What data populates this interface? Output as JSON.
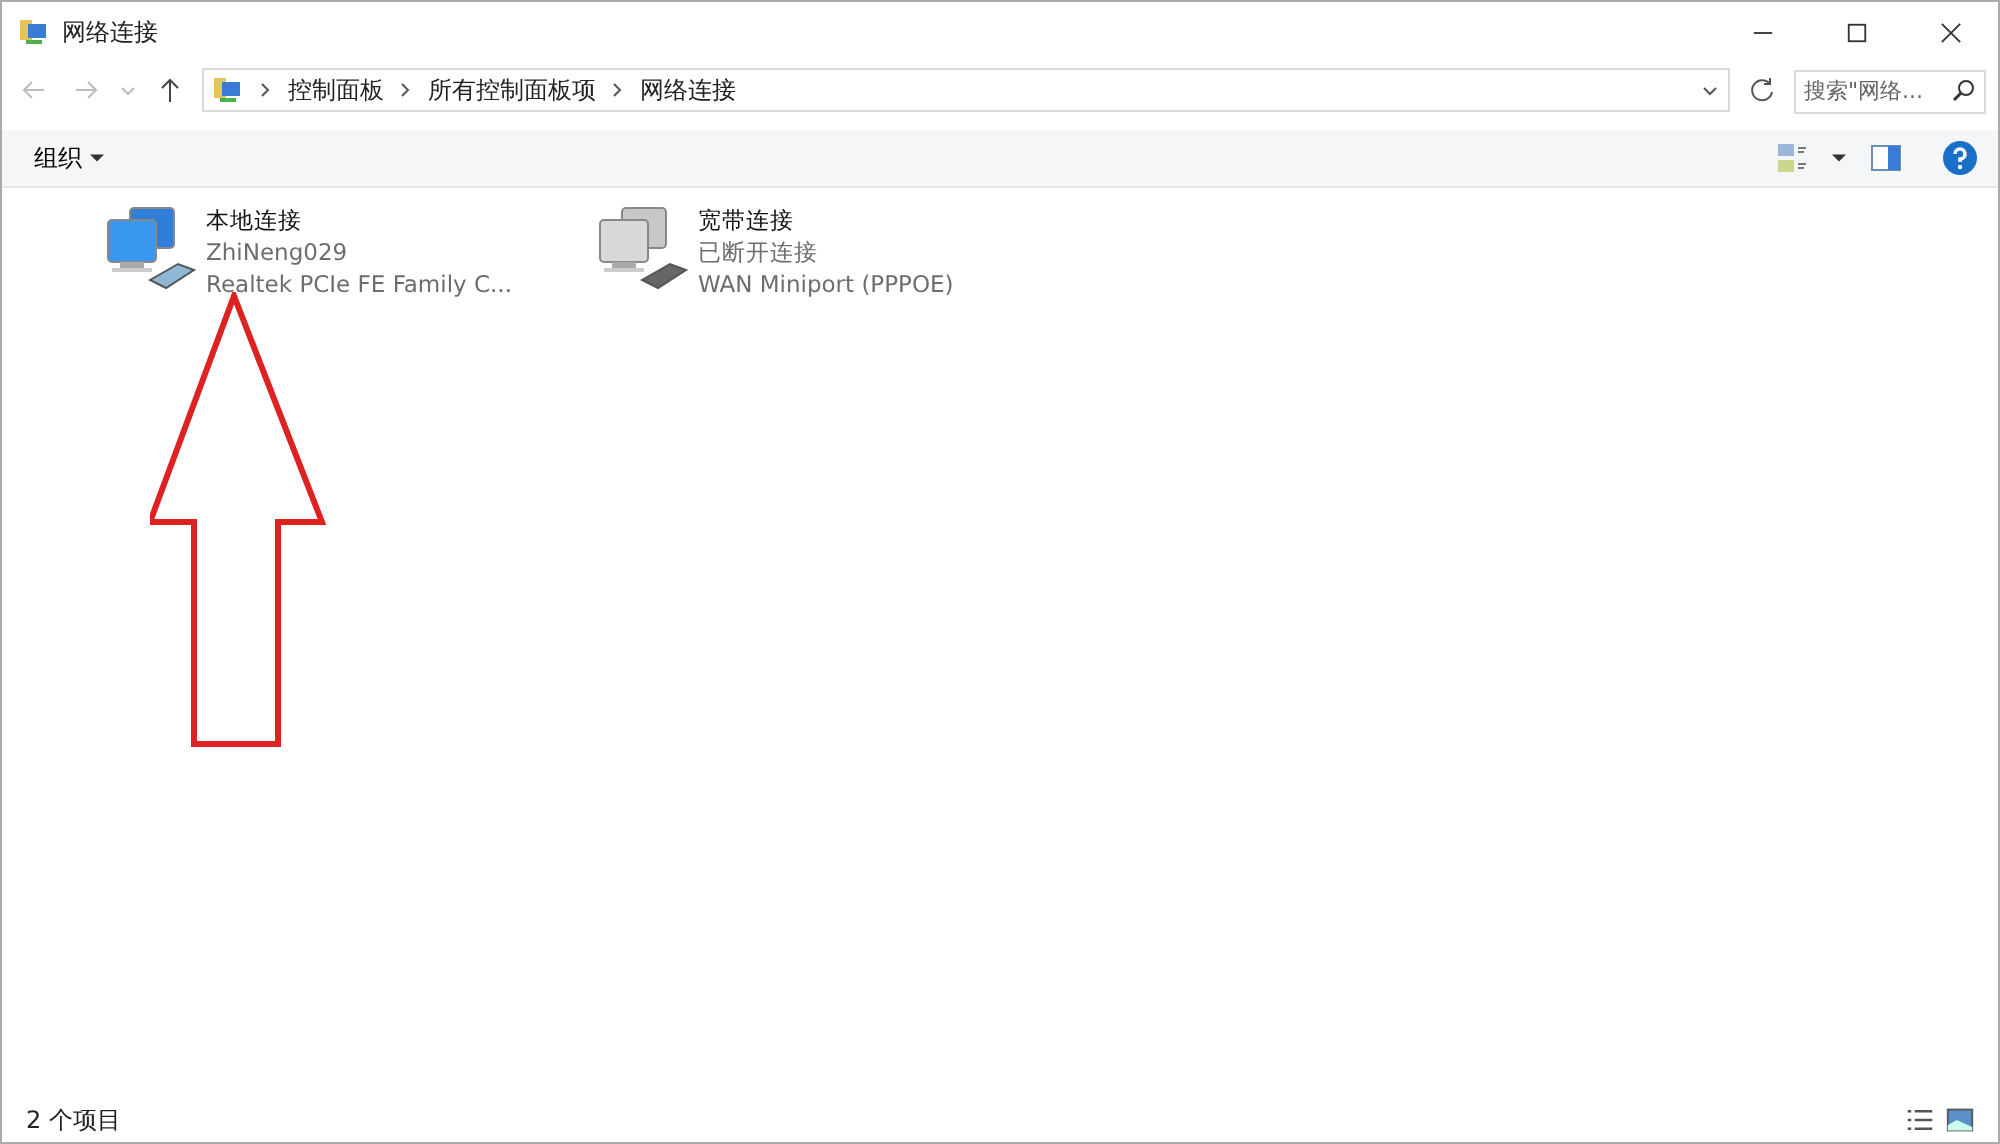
{
  "window": {
    "title": "网络连接"
  },
  "address_bar": {
    "crumbs": [
      "控制面板",
      "所有控制面板项",
      "网络连接"
    ]
  },
  "search": {
    "placeholder": "搜索\"网络..."
  },
  "toolbar": {
    "organize": "组织"
  },
  "connections": [
    {
      "name": "本地连接",
      "status": "ZhiNeng029",
      "device": "Realtek PCIe FE Family C...",
      "connected": true
    },
    {
      "name": "宽带连接",
      "status": "已断开连接",
      "device": "WAN Miniport (PPPOE)",
      "connected": false
    }
  ],
  "status_bar": {
    "count": "2 个项目"
  }
}
